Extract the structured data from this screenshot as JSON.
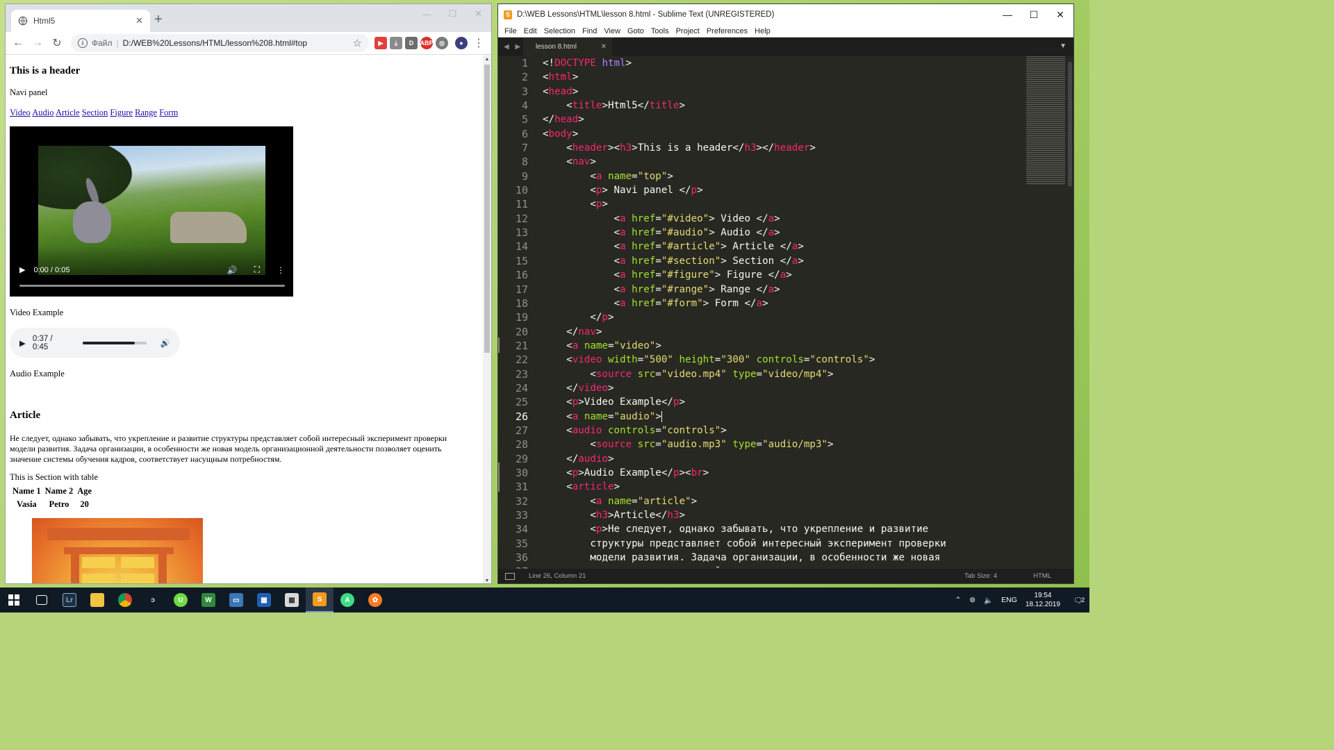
{
  "browser": {
    "tab_title": "Html5",
    "scheme_label": "Файл",
    "url": "D:/WEB%20Lessons/HTML/lesson%208.html#top"
  },
  "page": {
    "header": "This is a header",
    "navi": "Navi panel",
    "links": [
      "Video",
      "Audio",
      "Article",
      "Section",
      "Figure",
      "Range",
      "Form"
    ],
    "video_time": "0:00 / 0:05",
    "video_caption": "Video Example",
    "audio_time": "0:37 / 0:45",
    "audio_progress": 0.82,
    "audio_caption": "Audio Example",
    "article_title": "Article",
    "article_text": "Не следует, однако забывать, что укрепление и развитие структуры представляет собой интересный эксперимент проверки модели развития. Задача организации, в особенности же новая модель организационной деятельности позволяет оценить значение системы обучения кадров, соответствует насущным потребностям.",
    "section_text": "This is Section with table",
    "table_headers": [
      "Name 1",
      "Name 2",
      "Age"
    ],
    "table_row": [
      "Vasia",
      "Petro",
      "20"
    ]
  },
  "sublime": {
    "title": "D:\\WEB Lessons\\HTML\\lesson 8.html - Sublime Text (UNREGISTERED)",
    "menu": [
      "File",
      "Edit",
      "Selection",
      "Find",
      "View",
      "Goto",
      "Tools",
      "Project",
      "Preferences",
      "Help"
    ],
    "tab_name": "lesson 8.html",
    "status_position": "Line 26, Column 21",
    "status_tabsize": "Tab Size: 4",
    "status_syntax": "HTML",
    "active_line": 26
  },
  "taskbar": {
    "language": "ENG",
    "time": "19:54",
    "date": "18.12.2019",
    "notifications": "2"
  }
}
